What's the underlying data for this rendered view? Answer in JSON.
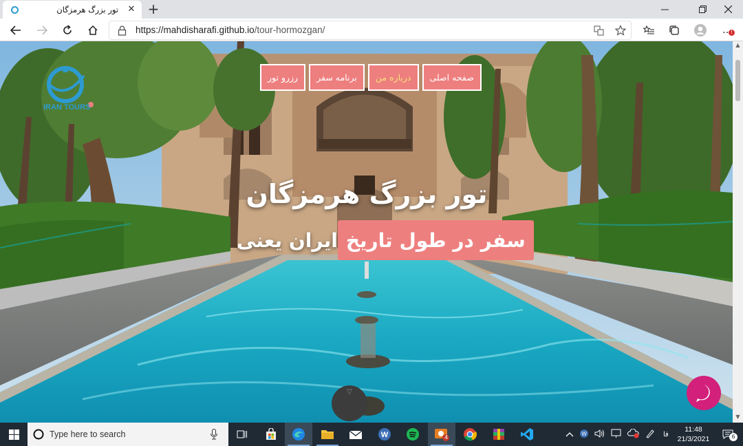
{
  "browser": {
    "tab_title": "تور بزرگ هرمزگان",
    "new_tab": "+",
    "url_domain": "https://mahdisharafi.github.io",
    "url_path": "/tour-hormozgan/",
    "more_label": "…"
  },
  "page": {
    "menu": [
      {
        "label": "صفحه اصلی",
        "active": false
      },
      {
        "label": "درباره من",
        "active": true
      },
      {
        "label": "برنامه سفر",
        "active": false
      },
      {
        "label": "رزرو تور",
        "active": false
      }
    ],
    "logo_text": "IRAN TOURS",
    "hero_title": "تور بزرگ هرمزگان",
    "hero_sub_plain": "ایران یعنی",
    "hero_sub_box": "سفر در طول تاریخ",
    "scroll_arrow": "▽"
  },
  "taskbar": {
    "search_placeholder": "Type here to search",
    "lang": "فا",
    "time": "11:48",
    "date": "21/3/2021",
    "notification_count": "6",
    "badge_count": "4"
  },
  "colors": {
    "accent": "#ee7f7f",
    "menu_active_text": "#f4e27a",
    "chat": "#d2207b",
    "taskbar": "#1f2a35"
  }
}
